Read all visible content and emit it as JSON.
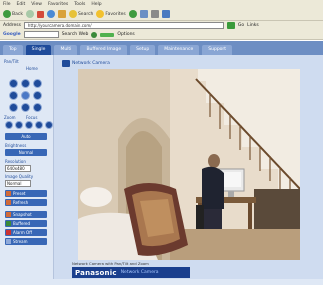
{
  "browser": {
    "menu": [
      "File",
      "Edit",
      "View",
      "Favorites",
      "Tools",
      "Help"
    ],
    "toolbar": {
      "back_label": "Back",
      "search_label": "Search",
      "favorites_label": "Favorites"
    },
    "address": {
      "label": "Address",
      "url": "http://yourcamera.domain.com/",
      "go_label": "Go",
      "links_label": "Links"
    },
    "linksbar": {
      "google_label": "Google",
      "search_web_label": "Search Web",
      "options_label": "Options"
    }
  },
  "nav": {
    "tabs": [
      "Top",
      "Single",
      "Multi",
      "Buffered Image",
      "Setup",
      "Maintenance",
      "Support"
    ]
  },
  "sidepanel": {
    "pan_tilt_label": "Pan/Tilt",
    "home_label": "Home",
    "zoom_label": "Zoom",
    "focus_label": "Focus",
    "auto_label": "Auto",
    "brightness_label": "Brightness",
    "normal_label": "Normal",
    "resolution_label": "Resolution",
    "resolution_value": "640x480",
    "quality_label": "Image Quality",
    "quality_value": "Normal",
    "buttons": [
      "Preset",
      "Refresh",
      "Snapshot",
      "Buffered",
      "Alarm Off",
      "Stream"
    ]
  },
  "content": {
    "title": "Network Camera",
    "caption": "Network Camera with Pan/Tilt and Zoom",
    "brand": "Panasonic",
    "brand_sub": "Network Camera"
  },
  "colors": {
    "nav_blue": "#6d8ec3",
    "active_tab": "#1f4b9a",
    "page_bg": "#cfdcf0",
    "logo_bg": "#1a3f8e"
  }
}
